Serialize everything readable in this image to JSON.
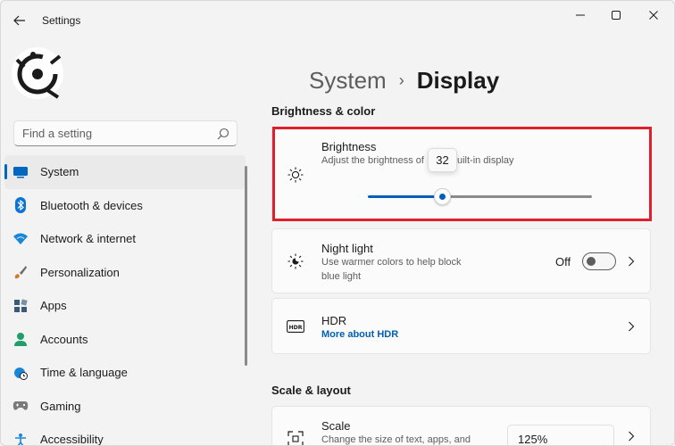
{
  "window": {
    "title": "Settings"
  },
  "search": {
    "placeholder": "Find a setting"
  },
  "sidebar": {
    "items": [
      {
        "label": "System",
        "icon": "system-icon",
        "color": "#0067c0",
        "active": true
      },
      {
        "label": "Bluetooth & devices",
        "icon": "bluetooth-icon",
        "color": "#0a74d4"
      },
      {
        "label": "Network & internet",
        "icon": "wifi-icon",
        "color": "#1a86d8"
      },
      {
        "label": "Personalization",
        "icon": "brush-icon",
        "color": "#d27b2c"
      },
      {
        "label": "Apps",
        "icon": "apps-icon",
        "color": "#3a5a7c"
      },
      {
        "label": "Accounts",
        "icon": "accounts-icon",
        "color": "#1e9e6a"
      },
      {
        "label": "Time & language",
        "icon": "globe-clock-icon",
        "color": "#1a86d8"
      },
      {
        "label": "Gaming",
        "icon": "gamepad-icon",
        "color": "#7a7a7a"
      },
      {
        "label": "Accessibility",
        "icon": "accessibility-icon",
        "color": "#1a86d8"
      }
    ]
  },
  "breadcrumb": {
    "parent": "System",
    "separator": "›",
    "current": "Display"
  },
  "sections": {
    "brightness_color": "Brightness & color",
    "scale_layout": "Scale & layout"
  },
  "brightness": {
    "title": "Brightness",
    "description_before": "Adjust the brightness of",
    "description_after": "uilt-in display",
    "value": 32,
    "tooltip": "32"
  },
  "night_light": {
    "title": "Night light",
    "description_line1": "Use warmer colors to help block",
    "description_line2": "blue light",
    "state_label": "Off",
    "on": false
  },
  "hdr": {
    "title": "HDR",
    "link": "More about HDR",
    "icon_text": "HDR"
  },
  "scale": {
    "title": "Scale",
    "description": "Change the size of text, apps, and",
    "value": "125%"
  },
  "colors": {
    "accent": "#005fb8",
    "highlight": "#e01e2c",
    "background": "#f3f3f3",
    "card": "#fbfbfb"
  }
}
